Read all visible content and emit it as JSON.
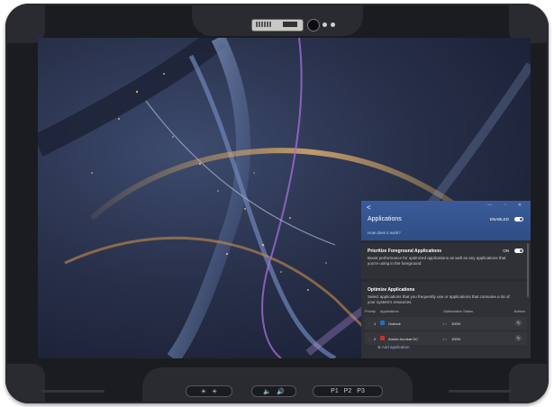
{
  "device": {
    "hw_buttons": {
      "brightness": [
        "☀",
        "☀"
      ],
      "volume": [
        "🔈",
        "🔊"
      ],
      "programmable": [
        "P1",
        "P2",
        "P3"
      ]
    }
  },
  "panel": {
    "back_icon": "<",
    "window_controls": "— ▫ ✕",
    "title": "Applications",
    "enabled_label": "ENABLED",
    "how_link": "How does it work?",
    "foreground": {
      "title": "Prioritize Foreground Applications",
      "state": "ON",
      "description": "Boost performance for optimized applications as well as any applications that you're using in the foreground"
    },
    "optimize": {
      "title": "Optimize Applications",
      "description": "Select applications that you frequently use or applications that consume a lot of your system's resources",
      "columns": [
        "Priority",
        "Applications",
        "Optimization Status",
        "Actions"
      ],
      "rows": [
        {
          "priority": "1",
          "app": "Outlook",
          "status": "100%",
          "icon_color": "#1e72c8"
        },
        {
          "priority": "2",
          "app": "Adobe Acrobat DC",
          "status": "100%",
          "icon_color": "#c8322b"
        }
      ],
      "add_label": "Add application"
    }
  }
}
